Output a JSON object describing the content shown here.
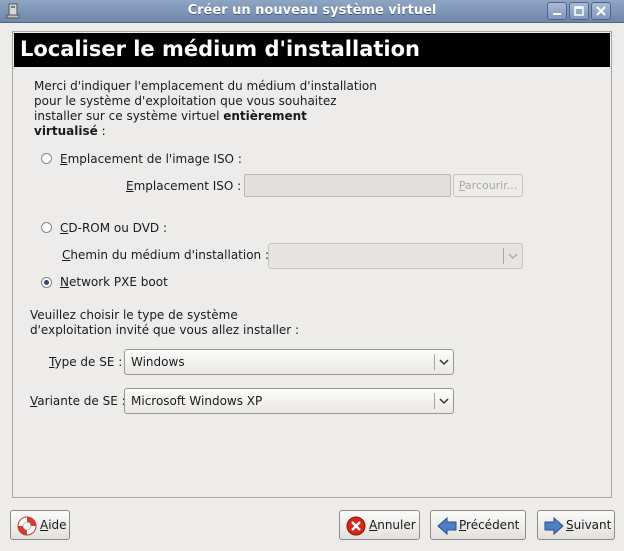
{
  "window": {
    "title": "Créer un nouveau système virtuel",
    "app_icon": "computer-icon",
    "controls": [
      "minimize-icon",
      "maximize-icon",
      "close-icon"
    ]
  },
  "banner": {
    "title": "Localiser le médium d'installation"
  },
  "intro": {
    "line1": "Merci d'indiquer l'emplacement du médium d'installation",
    "line2": "pour le système d'exploitation que vous souhaitez",
    "line3_prefix": "installer sur ce système virtuel ",
    "line3_bold": "entièrement",
    "line4_bold": "virtualisé",
    "line4_suffix": " :"
  },
  "iso": {
    "radio_first": "E",
    "radio_rest": "mplacement de l'image ISO :",
    "location_first": "E",
    "location_rest": "mplacement ISO :",
    "location_value": "",
    "browse_first": "P",
    "browse_rest": "arcourir...",
    "selected": false
  },
  "cdrom": {
    "radio_first": "C",
    "radio_rest": "D-ROM ou DVD :",
    "path_first": "C",
    "path_rest": "hemin du médium d'installation :",
    "path_value": "",
    "selected": false
  },
  "pxe": {
    "radio_first": "N",
    "radio_rest": "etwork PXE boot",
    "selected": true
  },
  "os_prompt": {
    "line1": "Veuillez choisir le type de système",
    "line2": "d'exploitation invité que vous allez installer :"
  },
  "os_type": {
    "label_first": "T",
    "label_rest": "ype de SE :",
    "value": "Windows"
  },
  "os_variant": {
    "label_first": "V",
    "label_rest": "ariante de SE :",
    "value": "Microsoft Windows XP"
  },
  "buttons": {
    "help": {
      "first": "A",
      "rest": "ide",
      "icon": "lifebuoy-help-icon"
    },
    "cancel": {
      "first": "A",
      "rest": "nnuler",
      "icon": "cancel-icon"
    },
    "back": {
      "first": "P",
      "rest": "récédent",
      "icon": "arrow-left-icon"
    },
    "forward": {
      "first": "S",
      "rest": "uivant",
      "icon": "arrow-right-icon"
    }
  },
  "colors": {
    "titlebar": "#7b93b5",
    "banner_bg": "#000000",
    "banner_text": "#ffffff",
    "radio_selected": "#2c4a7a"
  }
}
